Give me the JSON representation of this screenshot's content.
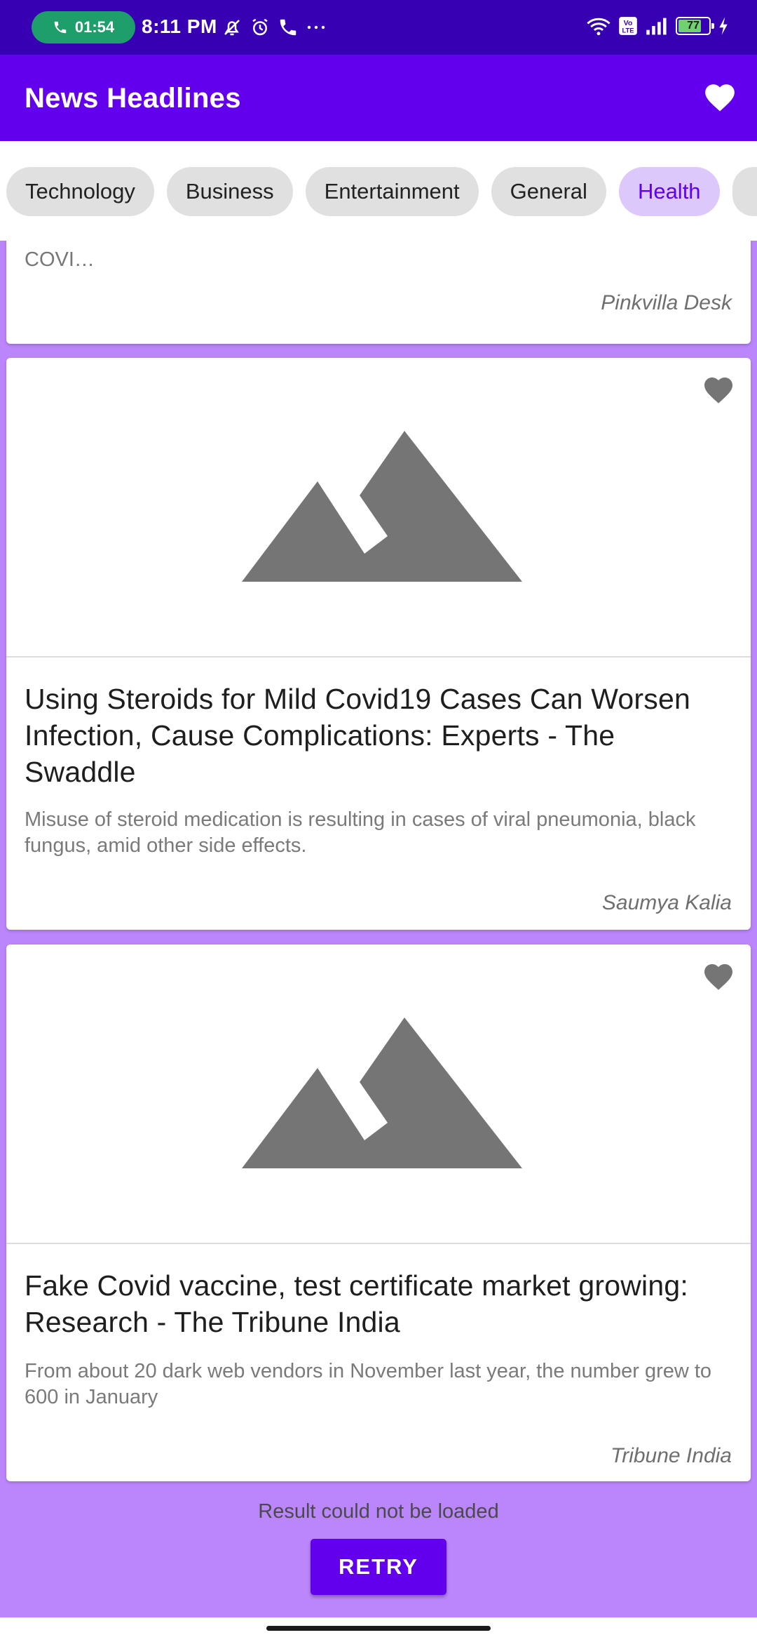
{
  "status_bar": {
    "call_timer": "01:54",
    "time": "8:11 PM",
    "battery_level": "77",
    "battery_fraction": 0.77,
    "icons_left": [
      "mute-icon",
      "alarm-icon",
      "phone-icon",
      "more-dots-icon"
    ],
    "icons_right": [
      "wifi-icon",
      "volte-icon",
      "signal-icon",
      "battery-icon",
      "charging-icon"
    ]
  },
  "app_bar": {
    "title": "News Headlines",
    "favorites_icon": "heart-icon"
  },
  "categories": [
    {
      "label": "Technology",
      "selected": false
    },
    {
      "label": "Business",
      "selected": false
    },
    {
      "label": "Entertainment",
      "selected": false
    },
    {
      "label": "General",
      "selected": false
    },
    {
      "label": "Health",
      "selected": true
    }
  ],
  "articles": [
    {
      "description": "COVI…",
      "author": "Pinkvilla Desk"
    },
    {
      "title": "Using Steroids for Mild Covid19 Cases Can Worsen Infection, Cause Complications: Experts - The Swaddle",
      "description": "Misuse of steroid medication is resulting in cases of viral pneumonia, black fungus, amid other side effects.",
      "author": "Saumya Kalia"
    },
    {
      "title": "Fake Covid vaccine, test certificate market growing: Research - The Tribune India",
      "description": "From about 20 dark web vendors in November last year, the number grew to 600 in January",
      "author": "Tribune India"
    }
  ],
  "footer": {
    "error_text": "Result could not be loaded",
    "retry_label": "RETRY"
  },
  "colors": {
    "status_bar": "#3700b3",
    "primary": "#6200ee",
    "feed_background": "#bb86fc",
    "chip_selected_bg": "#dcc8fb",
    "chip_bg": "#e0e0e0"
  }
}
